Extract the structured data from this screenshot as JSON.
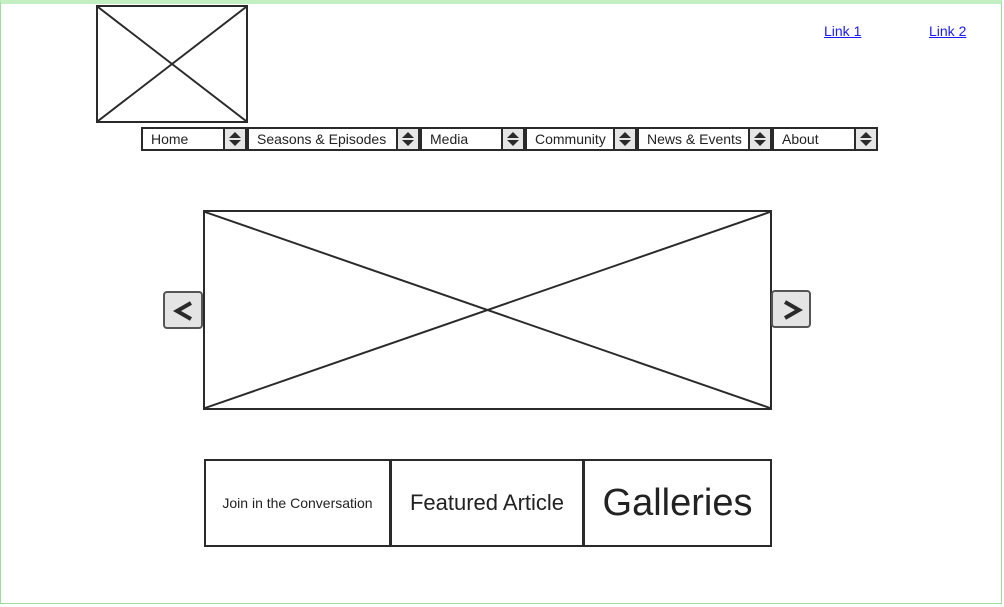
{
  "header": {
    "links": [
      {
        "label": "Link 1"
      },
      {
        "label": "Link 2"
      }
    ]
  },
  "nav": {
    "items": [
      {
        "label": "Home"
      },
      {
        "label": "Seasons & Episodes"
      },
      {
        "label": "Media"
      },
      {
        "label": "Community"
      },
      {
        "label": "News & Events"
      },
      {
        "label": "About"
      }
    ]
  },
  "carousel": {
    "prev_glyph": "<",
    "next_glyph": ">"
  },
  "tiles": [
    {
      "label": "Join in the Conversation"
    },
    {
      "label": "Featured Article"
    },
    {
      "label": "Galleries"
    }
  ],
  "colors": {
    "link": "#1a1aff",
    "stroke": "#2a2a2a",
    "frame_border": "#9fdc9f"
  }
}
